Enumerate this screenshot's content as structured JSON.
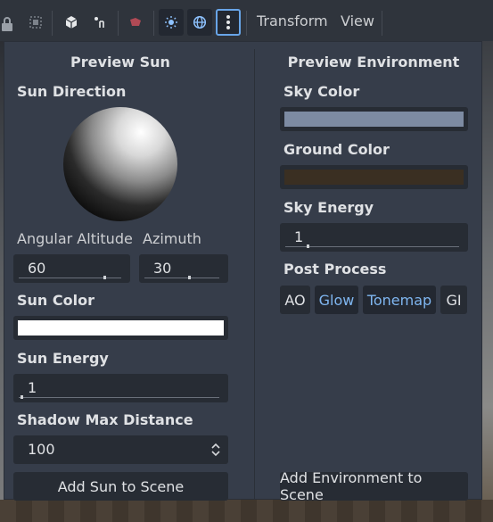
{
  "toolbar": {
    "icons": [
      "lock-icon",
      "snap-grid-icon",
      "mesh-cube-icon",
      "pivot-icon",
      "camera-icon",
      "sun-icon",
      "globe-icon",
      "more-icon"
    ],
    "menus": {
      "transform": "Transform",
      "view": "View"
    }
  },
  "colors": {
    "accent": "#68a5e8",
    "sky_color": "#7d8ba2",
    "ground_color": "#3a2f22",
    "sun_color": "#ffffff"
  },
  "sun": {
    "title": "Preview Sun",
    "direction_label": "Sun Direction",
    "altitude_label": "Angular Altitude",
    "azimuth_label": "Azimuth",
    "altitude_value": "60",
    "azimuth_value": "30",
    "color_label": "Sun Color",
    "energy_label": "Sun Energy",
    "energy_value": "1",
    "shadow_label": "Shadow Max Distance",
    "shadow_value": "100",
    "add_button": "Add Sun to Scene"
  },
  "environment": {
    "title": "Preview Environment",
    "sky_color_label": "Sky Color",
    "ground_color_label": "Ground Color",
    "sky_energy_label": "Sky Energy",
    "sky_energy_value": "1",
    "post_process_label": "Post Process",
    "toggles": [
      {
        "label": "AO",
        "on": false
      },
      {
        "label": "Glow",
        "on": true
      },
      {
        "label": "Tonemap",
        "on": true
      },
      {
        "label": "GI",
        "on": false
      }
    ],
    "add_button": "Add Environment to Scene"
  }
}
